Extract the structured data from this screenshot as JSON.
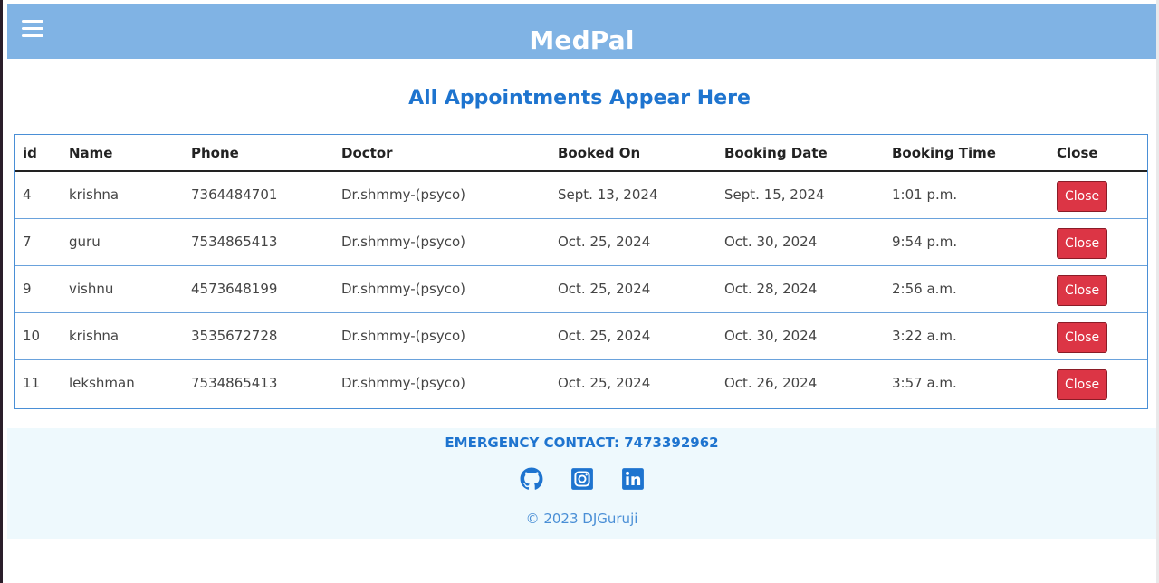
{
  "navbar": {
    "brand": "MedPal",
    "menu_icon": "hamburger-menu-icon"
  },
  "page": {
    "heading": "All Appointments Appear Here"
  },
  "table": {
    "headers": [
      "id",
      "Name",
      "Phone",
      "Doctor",
      "Booked On",
      "Booking Date",
      "Booking Time",
      "Close"
    ],
    "rows": [
      {
        "id": "4",
        "name": "krishna",
        "phone": "7364484701",
        "doctor": "Dr.shmmy-(psyco)",
        "booked_on": "Sept. 13, 2024",
        "booking_date": "Sept. 15, 2024",
        "booking_time": "1:01 p.m.",
        "action": "Close"
      },
      {
        "id": "7",
        "name": "guru",
        "phone": "7534865413",
        "doctor": "Dr.shmmy-(psyco)",
        "booked_on": "Oct. 25, 2024",
        "booking_date": "Oct. 30, 2024",
        "booking_time": "9:54 p.m.",
        "action": "Close"
      },
      {
        "id": "9",
        "name": "vishnu",
        "phone": "4573648199",
        "doctor": "Dr.shmmy-(psyco)",
        "booked_on": "Oct. 25, 2024",
        "booking_date": "Oct. 28, 2024",
        "booking_time": "2:56 a.m.",
        "action": "Close"
      },
      {
        "id": "10",
        "name": "krishna",
        "phone": "3535672728",
        "doctor": "Dr.shmmy-(psyco)",
        "booked_on": "Oct. 25, 2024",
        "booking_date": "Oct. 30, 2024",
        "booking_time": "3:22 a.m.",
        "action": "Close"
      },
      {
        "id": "11",
        "name": "lekshman",
        "phone": "7534865413",
        "doctor": "Dr.shmmy-(psyco)",
        "booked_on": "Oct. 25, 2024",
        "booking_date": "Oct. 26, 2024",
        "booking_time": "3:57 a.m.",
        "action": "Close"
      }
    ]
  },
  "footer": {
    "emergency": "EMERGENCY CONTACT: 7473392962",
    "socials": [
      "github-icon",
      "instagram-icon",
      "linkedin-icon"
    ],
    "copyright": "© 2023 DJGuruji"
  },
  "colors": {
    "navbar": "#80b3e4",
    "accent": "#1e74cf",
    "danger": "#dc3545",
    "footer_bg": "#eef9fd"
  }
}
